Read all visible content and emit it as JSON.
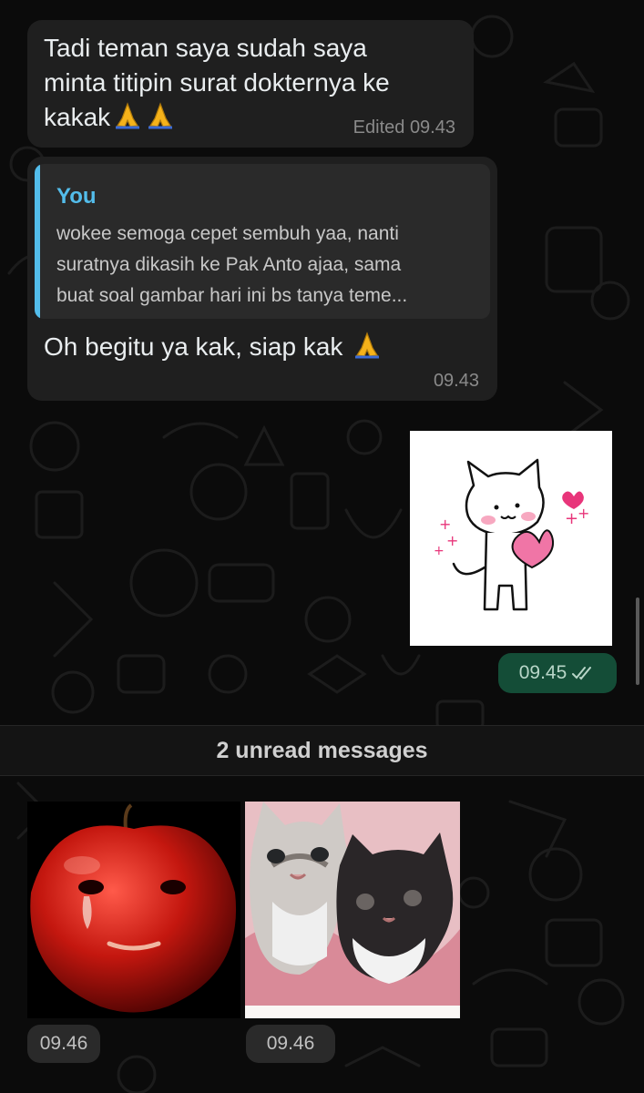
{
  "messages": [
    {
      "text": "Tadi teman saya sudah saya minta titipin surat dokternya ke kakak",
      "line1": "Tadi teman saya sudah saya",
      "line2": "minta titipin surat dokternya ke",
      "line3": "kakak",
      "edited_label": "Edited",
      "time": "09.43",
      "emoji": "folded-hands-icon"
    },
    {
      "reply": {
        "author": "You",
        "line1": "wokee semoga cepet sembuh yaa, nanti",
        "line2": "suratnya dikasih ke Pak Anto ajaa, sama",
        "line3": "buat soal gambar hari ini bs tanya teme..."
      },
      "text": "Oh begitu ya kak, siap kak",
      "time": "09.43"
    },
    {
      "type": "sticker",
      "description_icon": "cat-holding-heart-sticker",
      "time": "09.45",
      "status_icon": "double-check-icon"
    }
  ],
  "unread_divider": "2 unread messages",
  "incoming_stickers": [
    {
      "icon": "crying-apple-sticker",
      "time": "09.46"
    },
    {
      "icon": "two-kittens-sticker",
      "time": "09.46"
    }
  ],
  "colors": {
    "background": "#0b0b0b",
    "incoming_bubble": "#1f1f1f",
    "quote_bg": "#2a2a2a",
    "quote_accent": "#53bdeb",
    "outgoing_time_pill": "#144d37",
    "time_text": "#8a8a8a"
  }
}
